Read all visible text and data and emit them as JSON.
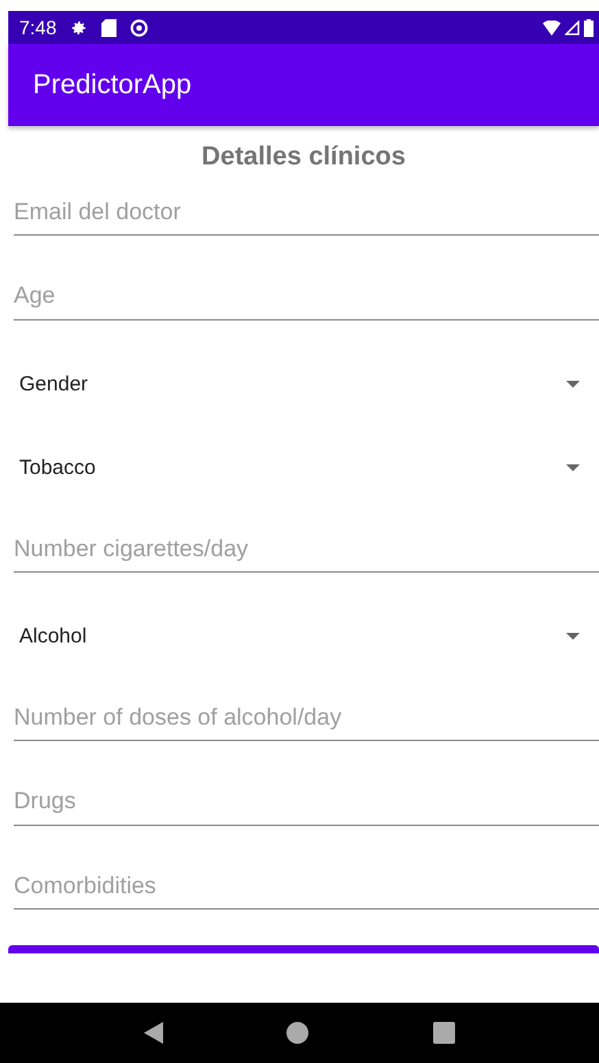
{
  "status_bar": {
    "time": "7:48"
  },
  "app_bar": {
    "title": "PredictorApp"
  },
  "form": {
    "heading": "Detalles clínicos",
    "fields": [
      {
        "kind": "text",
        "placeholder": "Email del doctor"
      },
      {
        "kind": "text",
        "placeholder": "Age"
      },
      {
        "kind": "select",
        "label": "Gender"
      },
      {
        "kind": "select",
        "label": "Tobacco"
      },
      {
        "kind": "text",
        "placeholder": "Number cigarettes/day"
      },
      {
        "kind": "select",
        "label": "Alcohol"
      },
      {
        "kind": "text",
        "placeholder": "Number of doses of alcohol/day"
      },
      {
        "kind": "text",
        "placeholder": "Drugs"
      },
      {
        "kind": "text",
        "placeholder": "Comorbidities"
      }
    ]
  }
}
